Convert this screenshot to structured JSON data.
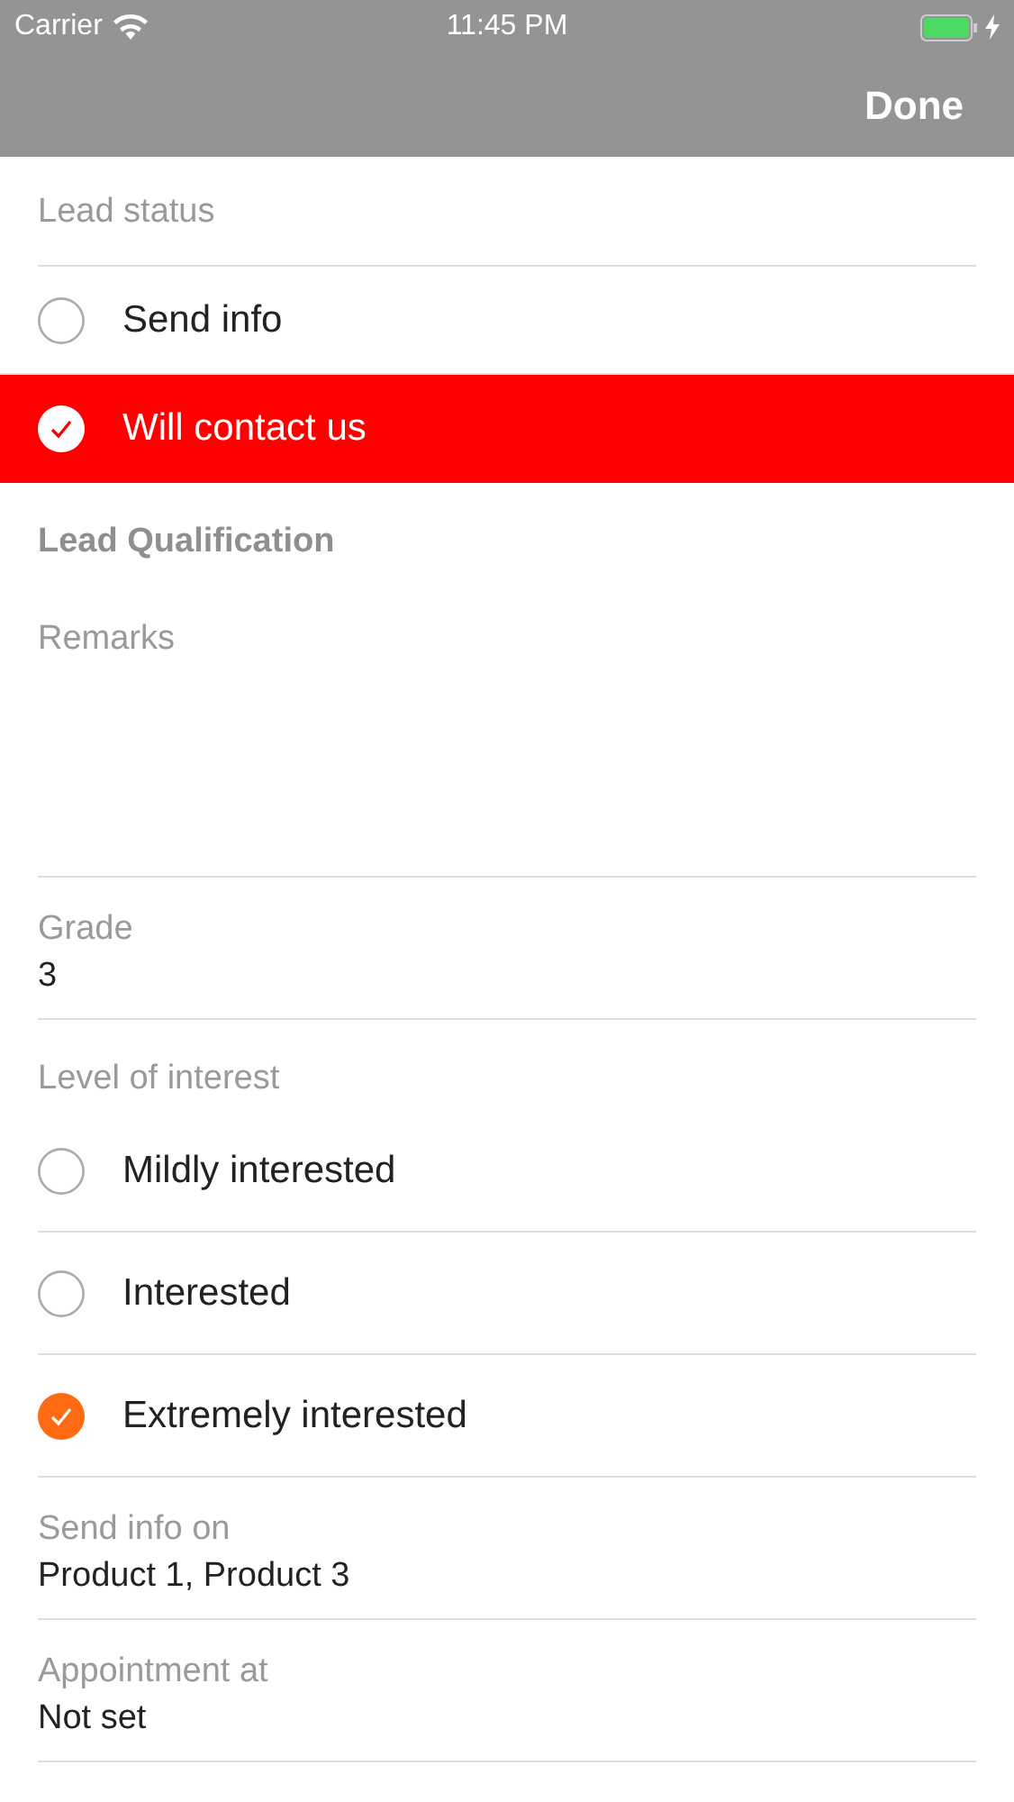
{
  "status_bar": {
    "carrier": "Carrier",
    "time": "11:45 PM",
    "charging": true
  },
  "nav_bar": {
    "done": "Done"
  },
  "sections": [
    {
      "kind": "highlight-radio-group",
      "title": "Lead status",
      "options": [
        {
          "label": "Send info",
          "selected": false
        },
        {
          "label": "Will contact us",
          "selected": true
        }
      ]
    },
    {
      "kind": "heading",
      "title": "Lead Qualification"
    },
    {
      "kind": "textarea",
      "title": "Remarks"
    },
    {
      "kind": "value",
      "title": "Grade",
      "value": "3"
    },
    {
      "kind": "dot-radio-group",
      "title": "Level of interest",
      "options": [
        {
          "label": "Mildly interested",
          "selected": false
        },
        {
          "label": "Interested",
          "selected": false
        },
        {
          "label": "Extremely interested",
          "selected": true
        }
      ]
    },
    {
      "kind": "value",
      "title": "Send info on",
      "value": "Product 1, Product 3"
    },
    {
      "kind": "value",
      "title": "Appointment at",
      "value": "Not set"
    }
  ]
}
